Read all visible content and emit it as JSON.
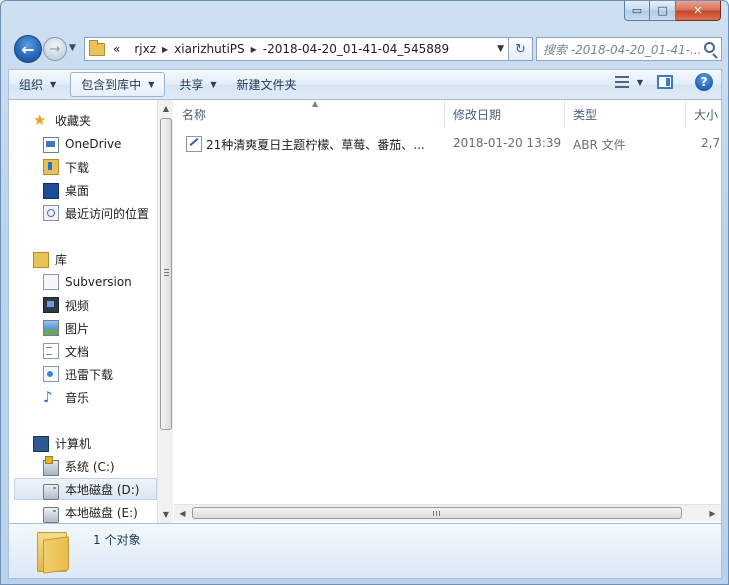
{
  "window": {
    "caption": {
      "minimize": "▭",
      "maximize": "□",
      "close": "✕"
    }
  },
  "address": {
    "overflow": "«",
    "crumbs": [
      "rjxz",
      "xiarizhutiPS",
      "-2018-04-20_01-41-04_545889"
    ],
    "search_placeholder": "搜索 -2018-04-20_01-41-..."
  },
  "toolbar": {
    "organize": "组织",
    "include_library": "包含到库中",
    "share": "共享",
    "new_folder": "新建文件夹"
  },
  "nav": {
    "favorites": "收藏夹",
    "onedrive": "OneDrive",
    "downloads": "下载",
    "desktop": "桌面",
    "recent": "最近访问的位置",
    "libraries": "库",
    "subversion": "Subversion",
    "videos": "视频",
    "pictures": "图片",
    "documents": "文档",
    "xunlei": "迅雷下载",
    "music": "音乐",
    "computer": "计算机",
    "drive_c": "系统 (C:)",
    "drive_d": "本地磁盘 (D:)",
    "drive_e": "本地磁盘 (E:)"
  },
  "columns": {
    "name": "名称",
    "modified": "修改日期",
    "type": "类型",
    "size": "大小"
  },
  "files": [
    {
      "name": "21种清爽夏日主题柠檬、草莓、番茄、...",
      "modified": "2018-01-20 13:39",
      "type": "ABR 文件",
      "size": "2,7"
    }
  ],
  "details": {
    "count": "1 个对象"
  }
}
